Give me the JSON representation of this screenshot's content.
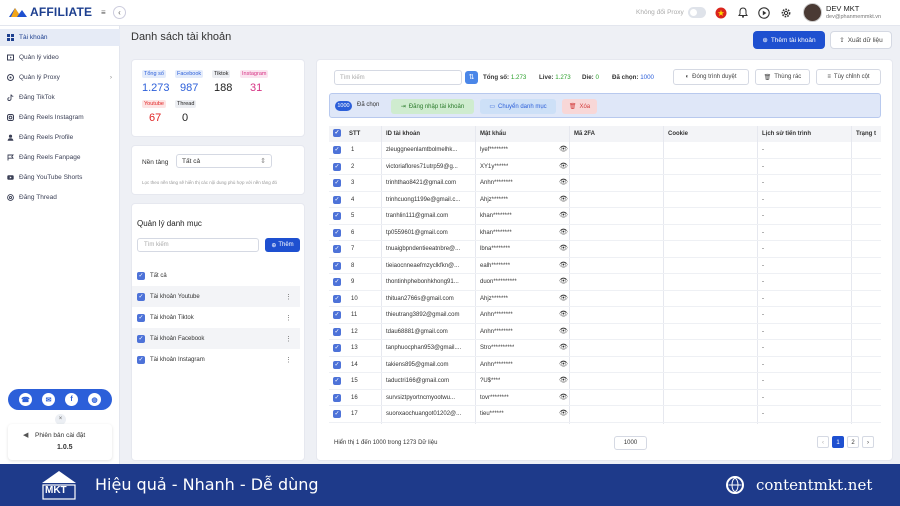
{
  "app": {
    "logo_text": "AFFILIATE",
    "proxy_label": "Không đổi Proxy",
    "user_name": "DEV MKT",
    "user_email": "dev@phanmemmkt.vn"
  },
  "sidebar": {
    "items": [
      {
        "label": "Tài khoản",
        "icon": "accounts-icon",
        "active": true
      },
      {
        "label": "Quản lý video",
        "icon": "video-icon"
      },
      {
        "label": "Quản lý Proxy",
        "icon": "proxy-icon",
        "has_sub": true
      },
      {
        "label": "Đăng TikTok",
        "icon": "tiktok-icon"
      },
      {
        "label": "Đăng Reels Instagram",
        "icon": "instagram-icon"
      },
      {
        "label": "Đăng Reels Profile",
        "icon": "profile-icon"
      },
      {
        "label": "Đăng Reels Fanpage",
        "icon": "fanpage-icon"
      },
      {
        "label": "Đăng YouTube Shorts",
        "icon": "youtube-icon"
      },
      {
        "label": "Đăng Thread",
        "icon": "thread-icon"
      }
    ],
    "version_label": "Phiên bản cài đặt",
    "version": "1.0.5"
  },
  "page": {
    "title": "Danh sách tài khoản",
    "add_button": "Thêm tài khoản",
    "export_button": "Xuất dữ liệu"
  },
  "platforms": [
    {
      "name": "Tổng số",
      "value": "1.273",
      "color": "#2c5fd9",
      "bg": "#e4ecfb"
    },
    {
      "name": "Facebook",
      "value": "987",
      "color": "#2c5fd9",
      "bg": "#e4ecfb"
    },
    {
      "name": "Tiktok",
      "value": "188",
      "color": "#222222",
      "bg": "#eceef2"
    },
    {
      "name": "Instagram",
      "value": "31",
      "color": "#d63384",
      "bg": "#fbe4f0"
    },
    {
      "name": "Youtube",
      "value": "67",
      "color": "#e02424",
      "bg": "#fde4e4"
    },
    {
      "name": "Thread",
      "value": "0",
      "color": "#222222",
      "bg": "#eceef2"
    }
  ],
  "platform_filter": {
    "label": "Nền tảng",
    "value": "Tất cả",
    "hint": "Lọc theo nền tảng sẽ hiển thị các nội dung phù hợp với nền tảng đó"
  },
  "categories": {
    "title": "Quản lý danh mục",
    "search_placeholder": "Tìm kiếm",
    "add_button": "Thêm",
    "items": [
      "Tất cả",
      "Tài khoản Youtube",
      "Tài khoản Tiktok",
      "Tài khoản Facebook",
      "Tài khoản Instagram"
    ]
  },
  "toolbar": {
    "search_placeholder": "Tìm kiếm",
    "total_label": "Tổng số:",
    "total": "1.273",
    "live_label": "Live:",
    "live": "1.273",
    "die_label": "Die:",
    "die": "0",
    "selected_label": "Đã chọn:",
    "selected": "1000",
    "browser_button": "Đóng trình duyệt",
    "trash_button": "Thùng rác",
    "columns_button": "Tùy chỉnh cột"
  },
  "selection_bar": {
    "count": "1000",
    "label": "Đã chọn",
    "login_button": "Đăng nhập tài khoản",
    "move_button": "Chuyển danh mục",
    "delete_button": "Xóa"
  },
  "table": {
    "headers": [
      "STT",
      "ID tài khoản",
      "Mật khẩu",
      "Mã 2FA",
      "Cookie",
      "Lịch sử tiến trình",
      "Trạng t"
    ],
    "rows": [
      {
        "stt": "1",
        "id": "zleuggneenlamtbolmelhk...",
        "pw": "lyef********",
        "hist": "-"
      },
      {
        "stt": "2",
        "id": "victoriaflores71utrp59@g...",
        "pw": "XY1y******",
        "hist": "-"
      },
      {
        "stt": "3",
        "id": "trinhthao8421@gmail.com",
        "pw": "Anhn********",
        "hist": "-"
      },
      {
        "stt": "4",
        "id": "trinhcuong1199e@gmail.c...",
        "pw": "Ahjz*******",
        "hist": "-"
      },
      {
        "stt": "5",
        "id": "tranhlin111@gmail.com",
        "pw": "khan********",
        "hist": "-"
      },
      {
        "stt": "6",
        "id": "tp0559601@gmail.com",
        "pw": "khan********",
        "hist": "-"
      },
      {
        "stt": "7",
        "id": "tnuaigbpndentieeatnbre@...",
        "pw": "lbna********",
        "hist": "-"
      },
      {
        "stt": "8",
        "id": "tieiaocnneaefmzyclkfkn@...",
        "pw": "ealh********",
        "hist": "-"
      },
      {
        "stt": "9",
        "id": "thontinhphebonhkhong91...",
        "pw": "duon**********",
        "hist": "-"
      },
      {
        "stt": "10",
        "id": "thituan2766s@gmail.com",
        "pw": "Ahjz*******",
        "hist": "-"
      },
      {
        "stt": "11",
        "id": "thieutrang3892@gmail.com",
        "pw": "Anhn********",
        "hist": "-"
      },
      {
        "stt": "12",
        "id": "tdau68881@gmail.com",
        "pw": "Anhn********",
        "hist": "-"
      },
      {
        "stt": "13",
        "id": "tanphuocphan953@gmail....",
        "pw": "Stro**********",
        "hist": "-"
      },
      {
        "stt": "14",
        "id": "takiens895@gmail.com",
        "pw": "Anhn********",
        "hist": "-"
      },
      {
        "stt": "15",
        "id": "taductri166@gmail.com",
        "pw": "?U$****",
        "hist": "-"
      },
      {
        "stt": "16",
        "id": "survsiztpyortncmyootwu...",
        "pw": "tovr********",
        "hist": "-"
      },
      {
        "stt": "17",
        "id": "suonxaochuangot01202@...",
        "pw": "tieu******",
        "hist": "-"
      }
    ]
  },
  "pagination": {
    "summary": "Hiển thị 1 đến 1000 trong 1273 Dữ liệu",
    "page_size": "1000",
    "prev": "‹",
    "pages": [
      "1",
      "2"
    ],
    "next": "›"
  },
  "footer": {
    "logo_text": "MKT",
    "slogan": "Hiệu quả - Nhanh - Dễ dùng",
    "site": "contentmkt.net"
  }
}
